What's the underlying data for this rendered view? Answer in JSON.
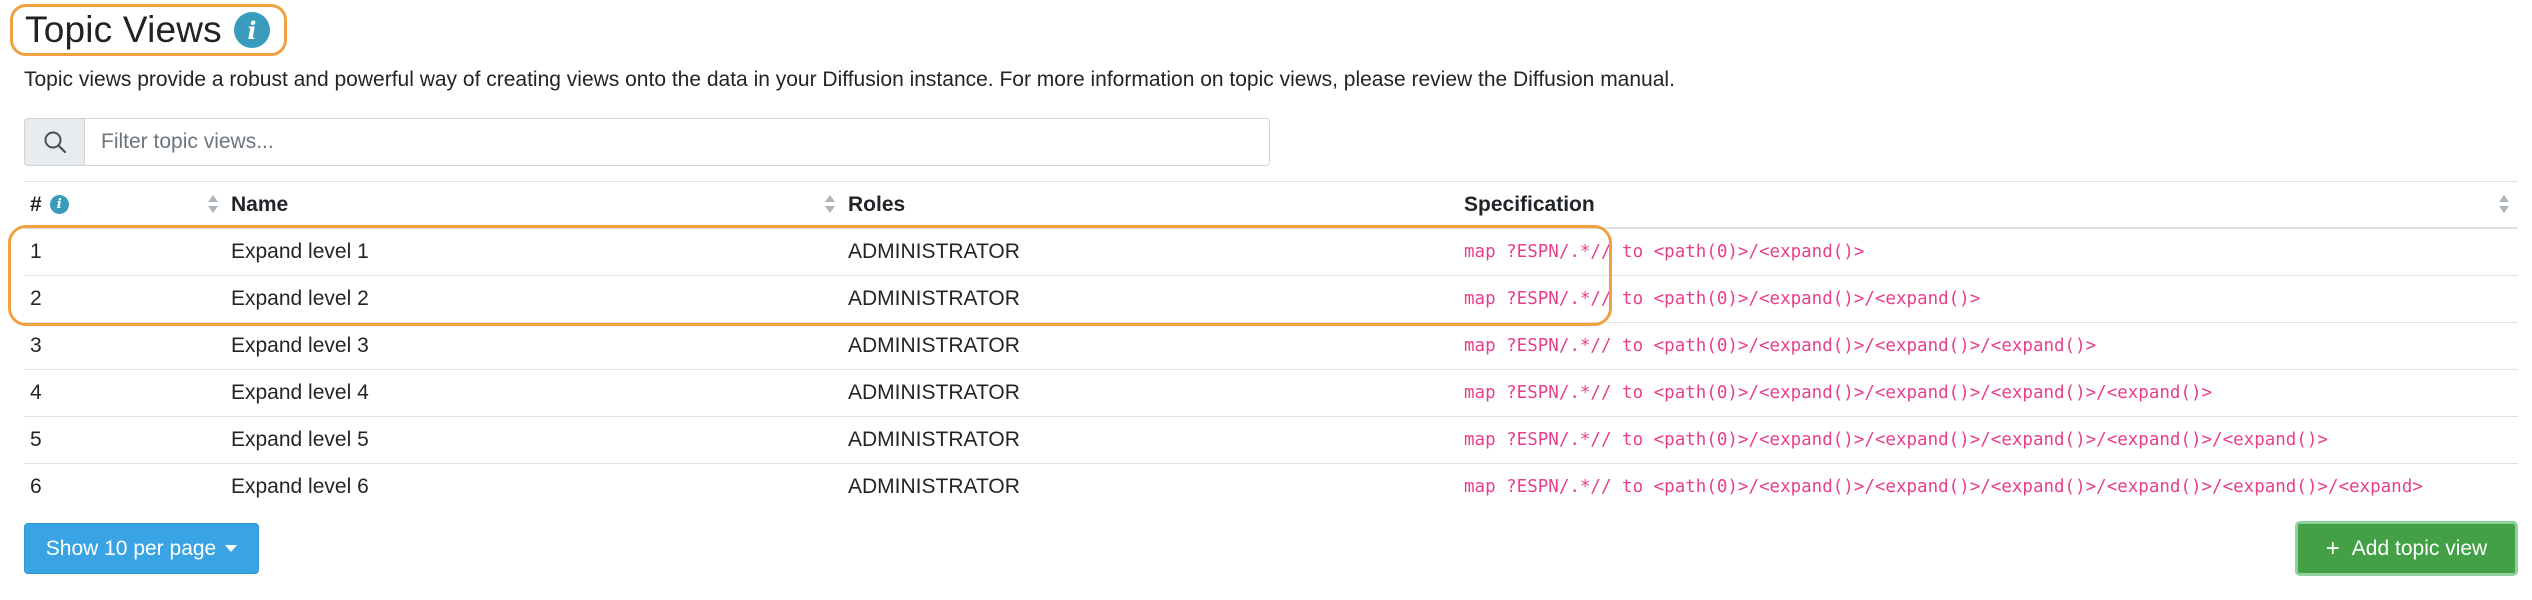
{
  "header": {
    "title": "Topic Views",
    "info_glyph": "i",
    "intro": "Topic views provide a robust and powerful way of creating views onto the data in your Diffusion instance. For more information on topic views, please review the Diffusion manual."
  },
  "search": {
    "icon": "search-icon",
    "placeholder": "Filter topic views..."
  },
  "table": {
    "columns": {
      "num": "#",
      "num_info": "i",
      "name": "Name",
      "roles": "Roles",
      "spec": "Specification"
    },
    "rows": [
      {
        "num": "1",
        "name": "Expand level 1",
        "roles": "ADMINISTRATOR",
        "spec": "map ?ESPN/.*// to <path(0)>/<expand()>"
      },
      {
        "num": "2",
        "name": "Expand level 2",
        "roles": "ADMINISTRATOR",
        "spec": "map ?ESPN/.*// to <path(0)>/<expand()>/<expand()>"
      },
      {
        "num": "3",
        "name": "Expand level 3",
        "roles": "ADMINISTRATOR",
        "spec": "map ?ESPN/.*// to <path(0)>/<expand()>/<expand()>/<expand()>"
      },
      {
        "num": "4",
        "name": "Expand level 4",
        "roles": "ADMINISTRATOR",
        "spec": "map ?ESPN/.*// to <path(0)>/<expand()>/<expand()>/<expand()>/<expand()>"
      },
      {
        "num": "5",
        "name": "Expand level 5",
        "roles": "ADMINISTRATOR",
        "spec": "map ?ESPN/.*// to <path(0)>/<expand()>/<expand()>/<expand()>/<expand()>/<expand()>"
      },
      {
        "num": "6",
        "name": "Expand level 6",
        "roles": "ADMINISTRATOR",
        "spec": "map ?ESPN/.*// to <path(0)>/<expand()>/<expand()>/<expand()>/<expand()>/<expand()>/<expand>"
      }
    ]
  },
  "footer": {
    "page_size_label": "Show 10 per page",
    "add_label": "Add topic view",
    "add_glyph": "+"
  },
  "colors": {
    "highlight": "#f0a040",
    "info": "#3a9cbd",
    "primary_button": "#3aa3e3",
    "success_button": "#43a047",
    "spec_text": "#e83e8c"
  }
}
